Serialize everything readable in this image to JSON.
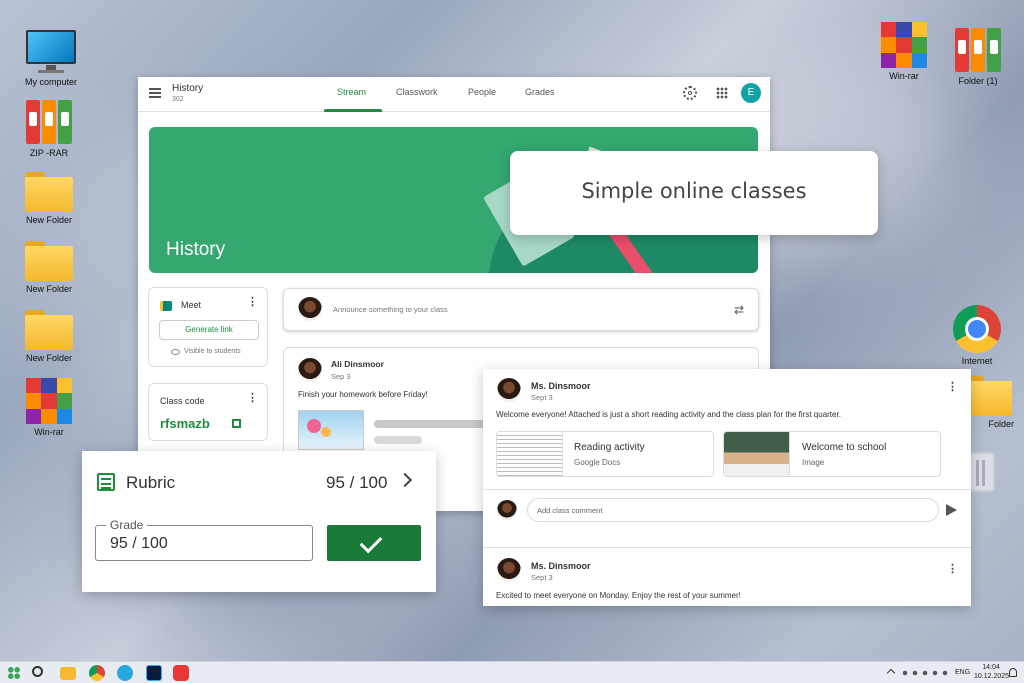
{
  "desktop": {
    "icons_left": [
      {
        "label": "My computer"
      },
      {
        "label": "ZIP -RAR"
      },
      {
        "label": "New Folder"
      },
      {
        "label": "New Folder"
      },
      {
        "label": "New Folder"
      },
      {
        "label": "Win-rar"
      }
    ],
    "icons_right": [
      {
        "label": "Win-rar"
      },
      {
        "label": "Folder (1)"
      },
      {
        "label": "Internet"
      },
      {
        "label": "Folder"
      }
    ]
  },
  "classroom": {
    "class_name": "History",
    "class_section": "302",
    "tabs": [
      "Stream",
      "Classwork",
      "People",
      "Grades"
    ],
    "avatar_letter": "E",
    "banner_title": "History",
    "meet": {
      "title": "Meet",
      "button": "Generate link",
      "visibility": "Visible to students"
    },
    "class_code": {
      "title": "Class code",
      "code": "rfsmazb"
    },
    "announce_placeholder": "Announce something to your class",
    "post": {
      "author": "Ali Dinsmoor",
      "date": "Sep 3",
      "text": "Finish your homework before Friday!"
    }
  },
  "callout": {
    "text": "Simple online classes"
  },
  "rubric": {
    "title": "Rubric",
    "score": "95 / 100",
    "grade_label": "Grade",
    "grade_value": "95 / 100"
  },
  "stream_panel": {
    "post1": {
      "author": "Ms. Dinsmoor",
      "date": "Sept 3",
      "text": "Welcome everyone! Attached is just a short reading activity and the class plan for the first quarter.",
      "attachments": [
        {
          "title": "Reading activity",
          "type": "Google Docs"
        },
        {
          "title": "Welcome to school",
          "type": "Image"
        }
      ],
      "comment_placeholder": "Add class comment"
    },
    "post2": {
      "author": "Ms. Dinsmoor",
      "date": "Sept 3",
      "text": "Excited to meet everyone on Monday. Enjoy the rest of your summer!"
    }
  },
  "taskbar": {
    "lang": "ENG",
    "time": "14:04",
    "date": "10.12.2025"
  },
  "colors": {
    "accent_green": "#1e8e3e",
    "banner": "#34a870",
    "teal_avatar": "#12a4a4",
    "rubric_button": "#197a39"
  }
}
